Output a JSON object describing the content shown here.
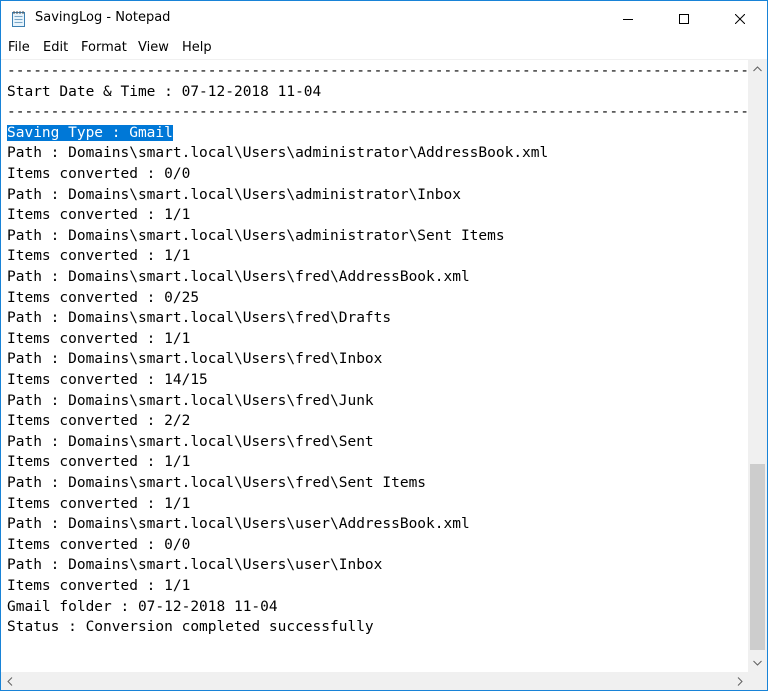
{
  "window": {
    "title": "SavingLog - Notepad"
  },
  "menu": [
    "File",
    "Edit",
    "Format",
    "View",
    "Help"
  ],
  "document": {
    "lines": [
      "--------------------------------------------------------------------------------------------------",
      "Start Date & Time : 07-12-2018 11-04",
      "--------------------------------------------------------------------------------------------------",
      "Saving Type : Gmail",
      "Path : Domains\\smart.local\\Users\\administrator\\AddressBook.xml",
      "Items converted : 0/0",
      "Path : Domains\\smart.local\\Users\\administrator\\Inbox",
      "Items converted : 1/1",
      "Path : Domains\\smart.local\\Users\\administrator\\Sent Items",
      "Items converted : 1/1",
      "Path : Domains\\smart.local\\Users\\fred\\AddressBook.xml",
      "Items converted : 0/25",
      "Path : Domains\\smart.local\\Users\\fred\\Drafts",
      "Items converted : 1/1",
      "Path : Domains\\smart.local\\Users\\fred\\Inbox",
      "Items converted : 14/15",
      "Path : Domains\\smart.local\\Users\\fred\\Junk",
      "Items converted : 2/2",
      "Path : Domains\\smart.local\\Users\\fred\\Sent",
      "Items converted : 1/1",
      "Path : Domains\\smart.local\\Users\\fred\\Sent Items",
      "Items converted : 1/1",
      "Path : Domains\\smart.local\\Users\\user\\AddressBook.xml",
      "Items converted : 0/0",
      "Path : Domains\\smart.local\\Users\\user\\Inbox",
      "Items converted : 1/1",
      "Gmail folder : 07-12-2018 11-04",
      "Status : Conversion completed successfully"
    ],
    "selected_line_index": 3
  },
  "colors": {
    "selection": "#0078d7",
    "border": "#1883d7",
    "scrollbar_track": "#f0f0f0",
    "scrollbar_thumb": "#cdcdcd"
  },
  "icons": {
    "app": "notepad-icon",
    "minimize": "minimize-icon",
    "maximize": "maximize-icon",
    "close": "close-icon"
  }
}
